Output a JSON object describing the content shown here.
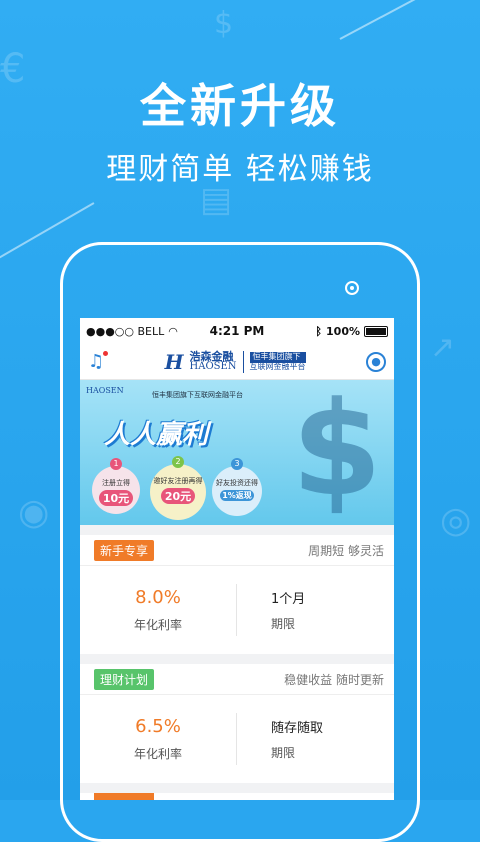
{
  "promo": {
    "headline": "全新升级",
    "subline": "理财简单  轻松赚钱"
  },
  "colors": {
    "background": "#2aa6ef",
    "accent_orange": "#f07b28",
    "tag_green": "#58c46b",
    "brand_blue": "#1a4fa0"
  },
  "status_bar": {
    "carrier": "●●●○○ BELL",
    "time": "4:21 PM",
    "battery": "100%"
  },
  "app_bar": {
    "logo_mark": "H",
    "logo_cn": "浩森金融",
    "logo_en": "HAOSEN",
    "logo_tag": "恒丰集团旗下",
    "logo_sub": "互联网金融平台",
    "left_icon": "bell-icon",
    "right_icon": "user-icon"
  },
  "banner": {
    "brand": "HAOSEN",
    "slogan": "恒丰集团旗下互联网金融平台",
    "title": "人人赢利",
    "symbol": "$",
    "steps": [
      {
        "num": "1",
        "text": "注册立得",
        "amount": "10元"
      },
      {
        "num": "2",
        "text": "邀好友注册再得",
        "amount": "20元"
      },
      {
        "num": "3",
        "text": "好友投资还得",
        "amount": "1%返现"
      }
    ]
  },
  "products": [
    {
      "tag": "新手专享",
      "features": "周期短  够灵活",
      "rate": "8.0%",
      "rate_label": "年化利率",
      "term": "1个月",
      "term_label": "期限"
    },
    {
      "tag": "理财计划",
      "features": "稳健收益  随时更新",
      "rate": "6.5%",
      "rate_label": "年化利率",
      "term": "随存随取",
      "term_label": "期限"
    }
  ]
}
